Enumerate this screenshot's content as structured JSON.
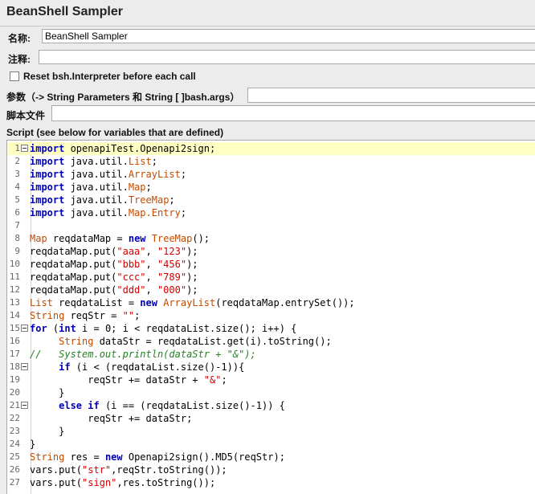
{
  "title": "BeanShell Sampler",
  "form": {
    "name_label": "名称:",
    "name_value": "BeanShell Sampler",
    "comment_label": "注释:",
    "comment_value": "",
    "reset_label": "Reset bsh.Interpreter before each call",
    "params_label": "参数（-> String Parameters 和 String [ ]bash.args）",
    "params_value": "",
    "script_file_label": "脚本文件",
    "script_file_value": "",
    "script_label": "Script (see below for variables that are defined)"
  },
  "colors": {
    "keyword": "#0000b8",
    "type": "#c44a00",
    "string": "#d40000",
    "comment": "#267f26",
    "current_line": "#ffffc4"
  },
  "editor": {
    "current_line": 1,
    "lines": [
      {
        "n": "1",
        "fold": true,
        "t": [
          [
            "kw",
            "import"
          ],
          [
            "pl",
            " openapiTest.Openapi2sign;"
          ]
        ]
      },
      {
        "n": "2",
        "t": [
          [
            "kw",
            "import"
          ],
          [
            "pl",
            " java.util."
          ],
          [
            "ty",
            "List"
          ],
          [
            "pl",
            ";"
          ]
        ]
      },
      {
        "n": "3",
        "t": [
          [
            "kw",
            "import"
          ],
          [
            "pl",
            " java.util."
          ],
          [
            "ty",
            "ArrayList"
          ],
          [
            "pl",
            ";"
          ]
        ]
      },
      {
        "n": "4",
        "t": [
          [
            "kw",
            "import"
          ],
          [
            "pl",
            " java.util."
          ],
          [
            "ty",
            "Map"
          ],
          [
            "pl",
            ";"
          ]
        ]
      },
      {
        "n": "5",
        "t": [
          [
            "kw",
            "import"
          ],
          [
            "pl",
            " java.util."
          ],
          [
            "ty",
            "TreeMap"
          ],
          [
            "pl",
            ";"
          ]
        ]
      },
      {
        "n": "6",
        "t": [
          [
            "kw",
            "import"
          ],
          [
            "pl",
            " java.util."
          ],
          [
            "ty",
            "Map.Entry"
          ],
          [
            "pl",
            ";"
          ]
        ]
      },
      {
        "n": "7",
        "t": []
      },
      {
        "n": "8",
        "t": [
          [
            "ty",
            "Map"
          ],
          [
            "pl",
            " reqdataMap = "
          ],
          [
            "kw",
            "new"
          ],
          [
            "pl",
            " "
          ],
          [
            "ty",
            "TreeMap"
          ],
          [
            "pl",
            "();"
          ]
        ]
      },
      {
        "n": "9",
        "t": [
          [
            "pl",
            "reqdataMap.put("
          ],
          [
            "st",
            "\"aaa\""
          ],
          [
            "pl",
            ", "
          ],
          [
            "st",
            "\"123\""
          ],
          [
            "pl",
            ");"
          ]
        ]
      },
      {
        "n": "10",
        "t": [
          [
            "pl",
            "reqdataMap.put("
          ],
          [
            "st",
            "\"bbb\""
          ],
          [
            "pl",
            ", "
          ],
          [
            "st",
            "\"456\""
          ],
          [
            "pl",
            ");"
          ]
        ]
      },
      {
        "n": "11",
        "t": [
          [
            "pl",
            "reqdataMap.put("
          ],
          [
            "st",
            "\"ccc\""
          ],
          [
            "pl",
            ", "
          ],
          [
            "st",
            "\"789\""
          ],
          [
            "pl",
            ");"
          ]
        ]
      },
      {
        "n": "12",
        "t": [
          [
            "pl",
            "reqdataMap.put("
          ],
          [
            "st",
            "\"ddd\""
          ],
          [
            "pl",
            ", "
          ],
          [
            "st",
            "\"000\""
          ],
          [
            "pl",
            ");"
          ]
        ]
      },
      {
        "n": "13",
        "t": [
          [
            "ty",
            "List"
          ],
          [
            "pl",
            " reqdataList = "
          ],
          [
            "kw",
            "new"
          ],
          [
            "pl",
            " "
          ],
          [
            "ty",
            "ArrayList"
          ],
          [
            "pl",
            "(reqdataMap.entrySet());"
          ]
        ]
      },
      {
        "n": "14",
        "t": [
          [
            "ty",
            "String"
          ],
          [
            "pl",
            " reqStr = "
          ],
          [
            "st",
            "\"\""
          ],
          [
            "pl",
            ";"
          ]
        ]
      },
      {
        "n": "15",
        "fold": true,
        "t": [
          [
            "kw",
            "for"
          ],
          [
            "pl",
            " ("
          ],
          [
            "kw",
            "int"
          ],
          [
            "pl",
            " i = 0; i < reqdataList.size(); i++) {"
          ]
        ]
      },
      {
        "n": "16",
        "t": [
          [
            "pl",
            "     "
          ],
          [
            "ty",
            "String"
          ],
          [
            "pl",
            " dataStr = reqdataList.get(i).toString();"
          ]
        ]
      },
      {
        "n": "17",
        "t": [
          [
            "cm",
            "//   System.out.println(dataStr + \"&\");"
          ]
        ]
      },
      {
        "n": "18",
        "fold": true,
        "t": [
          [
            "pl",
            "     "
          ],
          [
            "kw",
            "if"
          ],
          [
            "pl",
            " (i < (reqdataList.size()-1)){"
          ]
        ]
      },
      {
        "n": "19",
        "t": [
          [
            "pl",
            "          reqStr += dataStr + "
          ],
          [
            "st",
            "\"&\""
          ],
          [
            "pl",
            ";"
          ]
        ]
      },
      {
        "n": "20",
        "t": [
          [
            "pl",
            "     }"
          ]
        ]
      },
      {
        "n": "21",
        "fold": true,
        "t": [
          [
            "pl",
            "     "
          ],
          [
            "kw",
            "else"
          ],
          [
            "pl",
            " "
          ],
          [
            "kw",
            "if"
          ],
          [
            "pl",
            " (i == (reqdataList.size()-1)) {"
          ]
        ]
      },
      {
        "n": "22",
        "t": [
          [
            "pl",
            "          reqStr += dataStr;"
          ]
        ]
      },
      {
        "n": "23",
        "t": [
          [
            "pl",
            "     }"
          ]
        ]
      },
      {
        "n": "24",
        "t": [
          [
            "pl",
            "}"
          ]
        ]
      },
      {
        "n": "25",
        "t": [
          [
            "ty",
            "String"
          ],
          [
            "pl",
            " res = "
          ],
          [
            "kw",
            "new"
          ],
          [
            "pl",
            " Openapi2sign().MD5(reqStr);"
          ]
        ]
      },
      {
        "n": "26",
        "t": [
          [
            "pl",
            "vars.put("
          ],
          [
            "st",
            "\"str\""
          ],
          [
            "pl",
            ",reqStr.toString());"
          ]
        ]
      },
      {
        "n": "27",
        "t": [
          [
            "pl",
            "vars.put("
          ],
          [
            "st",
            "\"sign\""
          ],
          [
            "pl",
            ",res.toString());"
          ]
        ]
      }
    ]
  }
}
